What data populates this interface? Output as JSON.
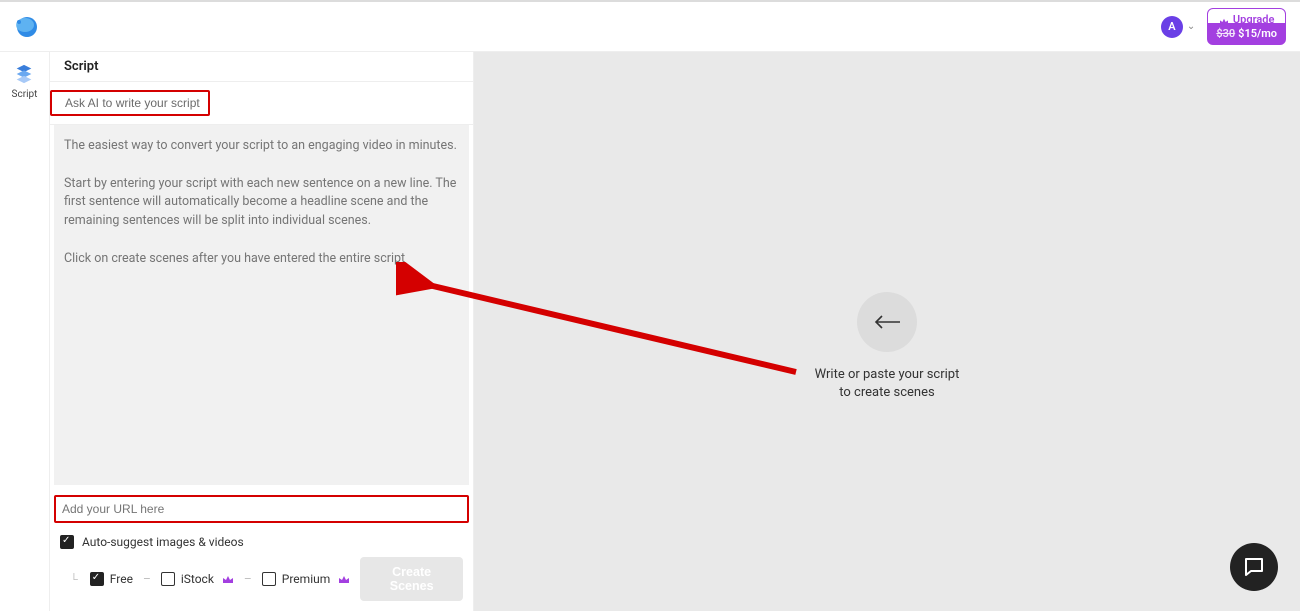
{
  "header": {
    "avatar_letter": "A",
    "upgrade_label": "Upgrade",
    "price_struck": "$30",
    "price_current": "$15/mo"
  },
  "sidebar": {
    "items": [
      {
        "label": "Script"
      }
    ]
  },
  "panel": {
    "title": "Script",
    "ask_ai_label": "Ask AI to write your script"
  },
  "script_textarea": {
    "placeholder": "The easiest way to convert your script to an engaging video in minutes.\n\nStart by entering your script with each new sentence on a new line. The first sentence will automatically become a headline scene and the remaining sentences will be split into individual scenes.\n\nClick on create scenes after you have entered the entire script",
    "value": ""
  },
  "url_input": {
    "placeholder": "Add your URL here",
    "value": ""
  },
  "options": {
    "auto_suggest_label": "Auto-suggest images & videos",
    "auto_suggest_checked": true,
    "sources": [
      {
        "label": "Free",
        "checked": true,
        "premium_icon": false
      },
      {
        "label": "iStock",
        "checked": false,
        "premium_icon": true
      },
      {
        "label": "Premium",
        "checked": false,
        "premium_icon": true
      }
    ]
  },
  "create_button_label": "Create Scenes",
  "canvas": {
    "empty_line1": "Write or paste your script",
    "empty_line2": "to create scenes"
  },
  "colors": {
    "highlight": "#d40000",
    "accent": "#a33fe0",
    "avatar": "#6a3fe6"
  }
}
